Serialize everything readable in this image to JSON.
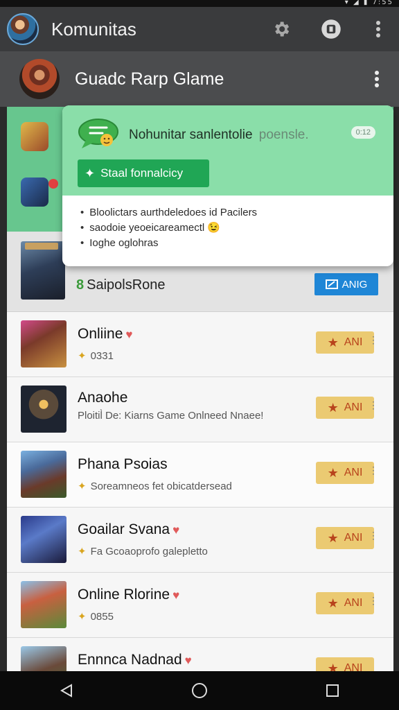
{
  "status_bar": {
    "right_text": "▾ ◢ ▮ 7:55"
  },
  "app_bar": {
    "title": "Komunitas",
    "icons": [
      "gear-icon",
      "game-icon",
      "more-vert-icon"
    ]
  },
  "community_header": {
    "title": "Guadc Rarp Glame",
    "icon": "more-vert-icon"
  },
  "popup": {
    "headline": "Nohunitar sanlentolie",
    "headline_suffix": "poensle.",
    "badge": "0:12",
    "action_label": "Staal fonnalcicy",
    "bullets": [
      "Bloolictars aurthdeledoes id Pacilers",
      "saodoie yeoeicareamectl 😉",
      "Ioghe oglohras"
    ]
  },
  "featured": {
    "num": "8",
    "name": "SaipolsRone",
    "button_label": "ANIG"
  },
  "games": [
    {
      "name": "Onliine",
      "heart": true,
      "sub": "0331",
      "button": "ANI"
    },
    {
      "name": "Anaohe",
      "heart": false,
      "sub": "Ploitil̀ De: Kiarns Game Onlneed Nnaee!",
      "button": "ANI"
    },
    {
      "name": "Phana Psoias",
      "heart": false,
      "sub": "Soreamneos fet obicatdersead",
      "button": "ANI"
    },
    {
      "name": "Goailar Svana",
      "heart": true,
      "sub": "Fa Gcoaoprofo galepletto",
      "button": "ANI"
    },
    {
      "name": "Online Rlorine",
      "heart": true,
      "sub": "0855",
      "button": "ANI"
    },
    {
      "name": "Ennnca Nadnad",
      "heart": true,
      "sub": "",
      "button": "ANI"
    }
  ],
  "colors": {
    "app_bar": "#3a3b3d",
    "green": "#67c68e",
    "popup_green": "#8adea9",
    "action_button": "#20a655",
    "blue_button": "#1f86d6",
    "gold_button": "#ebca72"
  }
}
